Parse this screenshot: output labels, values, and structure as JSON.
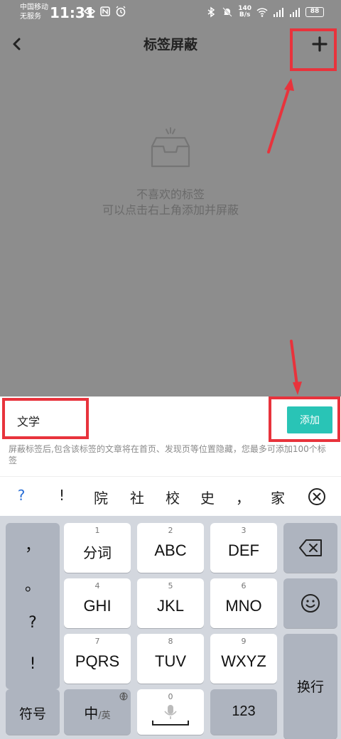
{
  "status_bar": {
    "carrier_line1": "中国移动",
    "carrier_line2": "无服务",
    "time": "11:31",
    "net_speed_value": "140",
    "net_speed_unit": "B/s",
    "battery": "88"
  },
  "nav": {
    "title": "标签屏蔽"
  },
  "empty_state": {
    "line1": "不喜欢的标签",
    "line2": "可以点击右上角添加并屏蔽"
  },
  "input_panel": {
    "tag_value": "文学",
    "add_label": "添加",
    "hint": "屏蔽标签后,包含该标签的文章将在首页、发现页等位置隐藏，您最多可添加100个标签"
  },
  "candidates": [
    "?",
    "!",
    "院",
    "社",
    "校",
    "史",
    "，",
    "家"
  ],
  "keyboard": {
    "punctuation": [
      "，",
      "。",
      "?",
      "!"
    ],
    "rows": [
      [
        {
          "num": "1",
          "label": "分词"
        },
        {
          "num": "2",
          "label": "ABC"
        },
        {
          "num": "3",
          "label": "DEF"
        }
      ],
      [
        {
          "num": "4",
          "label": "GHI"
        },
        {
          "num": "5",
          "label": "JKL"
        },
        {
          "num": "6",
          "label": "MNO"
        }
      ],
      [
        {
          "num": "7",
          "label": "PQRS"
        },
        {
          "num": "8",
          "label": "TUV"
        },
        {
          "num": "9",
          "label": "WXYZ"
        }
      ]
    ],
    "symbols_label": "符号",
    "lang_main": "中",
    "lang_sub": "/英",
    "space_num": "0",
    "numbers_label": "123",
    "enter_label": "换行"
  },
  "colors": {
    "accent": "#29c4b6",
    "annotation_red": "#e8333c",
    "overlay": "#8d8d8d"
  }
}
